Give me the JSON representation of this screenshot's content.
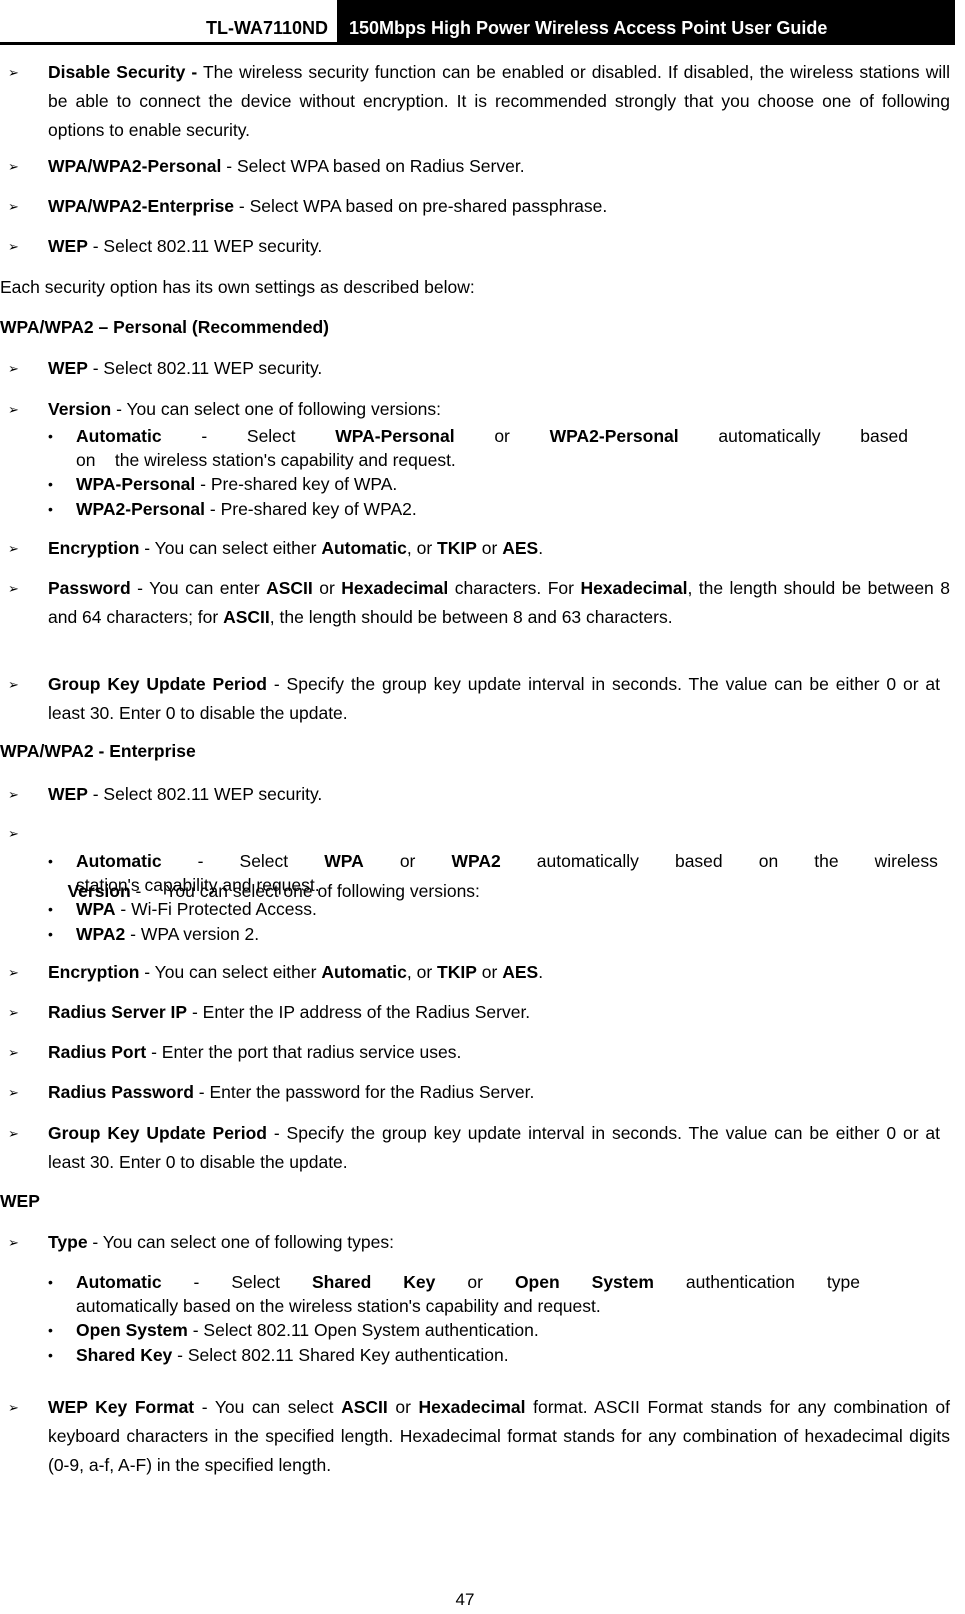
{
  "header": {
    "model": "TL-WA7110ND",
    "title": "150Mbps High Power Wireless Access Point User Guide"
  },
  "intro_items": [
    {
      "term": "Disable Security -",
      "text": " The wireless security function can be enabled or disabled. If disabled, the wireless stations will be able to connect the device without encryption. It is recommended strongly that you choose one of following options to enable security."
    },
    {
      "term": "WPA/WPA2-Personal",
      "text": " - Select WPA based on Radius Server."
    },
    {
      "term": "WPA/WPA2-Enterprise",
      "text": " - Select WPA based on pre-shared passphrase."
    },
    {
      "term": "WEP",
      "text": " - Select 802.11 WEP security."
    }
  ],
  "each_option_text": "Each security option has its own settings as described below:",
  "personal": {
    "heading": "WPA/WPA2 – Personal (Recommended)",
    "wep": {
      "term": "WEP",
      "text": " - Select 802.11 WEP security."
    },
    "version": {
      "term": "Version",
      "text": " - You can select one of following versions:"
    },
    "versions": {
      "automatic": {
        "t1": "Automatic",
        "t2": "-",
        "t3": "Select",
        "t4": "WPA-Personal",
        "t5": "or",
        "t6": "WPA2-Personal",
        "t7": "automatically",
        "t8": "based",
        "line2": "on    the wireless station's capability and request."
      },
      "wpa": {
        "term": "WPA-Personal",
        "text": " - Pre-shared key of WPA."
      },
      "wpa2": {
        "term": "WPA2-Personal",
        "text": " - Pre-shared key of WPA2."
      }
    },
    "encryption": {
      "term": "Encryption",
      "pre": " - You can select either ",
      "b1": "Automatic",
      "mid": ", or ",
      "b2": "TKIP",
      "mid2": " or ",
      "b3": "AES",
      "end": "."
    },
    "password": {
      "term": "Password",
      "pre": " - You can enter ",
      "b1": "ASCII",
      "mid": " or ",
      "b2": "Hexadecimal",
      "mid2": " characters. For ",
      "b3": "Hexadecimal",
      "mid3": ", the length should be between 8 and 64 characters; for ",
      "b4": "ASCII",
      "end": ", the length should be between 8 and 63 characters."
    },
    "group_key": {
      "term": "Group Key Update Period",
      "text": " - Specify the group key update interval in seconds. The value can be either 0 or at least 30. Enter 0 to disable the update."
    }
  },
  "enterprise": {
    "heading": "WPA/WPA2 - Enterprise",
    "wep": {
      "term": "WEP",
      "text": " - Select 802.11 WEP security."
    },
    "version": {
      "term": "Version",
      "text": " -     You can select one of following versions:"
    },
    "versions": {
      "automatic": {
        "t1": "Automatic",
        "t2": "-",
        "t3": "Select",
        "t4": "WPA",
        "t5": "or",
        "t6": "WPA2",
        "t7": "automatically",
        "t8": "based",
        "t9": "on",
        "t10": "the",
        "t11": "wireless",
        "line2": "station's capability and request."
      },
      "wpa": {
        "term": "WPA",
        "text": " - Wi-Fi Protected Access."
      },
      "wpa2": {
        "term": "WPA2",
        "text": " - WPA version 2."
      }
    },
    "encryption": {
      "term": "Encryption",
      "pre": " - You can select either ",
      "b1": "Automatic",
      "mid": ", or ",
      "b2": "TKIP",
      "mid2": " or ",
      "b3": "AES",
      "end": "."
    },
    "radius_ip": {
      "term": "Radius Server IP",
      "text": " - Enter the IP address of the Radius Server."
    },
    "radius_port": {
      "term": "Radius Port",
      "text": " - Enter the port that radius service uses."
    },
    "radius_password": {
      "term": "Radius Password",
      "text": " - Enter the password for the Radius Server."
    },
    "group_key": {
      "term": "Group Key Update Period",
      "text": " - Specify the group key update interval in seconds. The value can be either 0 or at least 30. Enter 0 to disable the update."
    }
  },
  "wep": {
    "heading": "WEP",
    "type": {
      "term": "Type",
      "text": " - You can select one of following types:"
    },
    "types": {
      "automatic": {
        "t1": "Automatic",
        "t2": "-",
        "t3": "Select",
        "t4": "Shared",
        "t5": "Key",
        "t6": "or",
        "t7": "Open",
        "t8": "System",
        "t9": "authentication",
        "t10": "type",
        "line2": "automatically based on the wireless station's capability and request."
      },
      "open": {
        "term": "Open System",
        "text": " - Select 802.11 Open System authentication."
      },
      "shared": {
        "term": "Shared Key",
        "text": " - Select 802.11 Shared Key authentication."
      }
    },
    "key_format": {
      "term": "WEP Key Format",
      "pre": " - You can select ",
      "b1": "ASCII",
      "mid": " or ",
      "b2": "Hexadecimal",
      "end": " format. ASCII Format stands for any combination of keyboard characters in the specified length. Hexadecimal format stands for any combination of hexadecimal digits (0-9, a-f, A-F) in the specified length."
    }
  },
  "icons": {
    "arrow": "➢",
    "bullet": "•"
  },
  "page_number": "47"
}
